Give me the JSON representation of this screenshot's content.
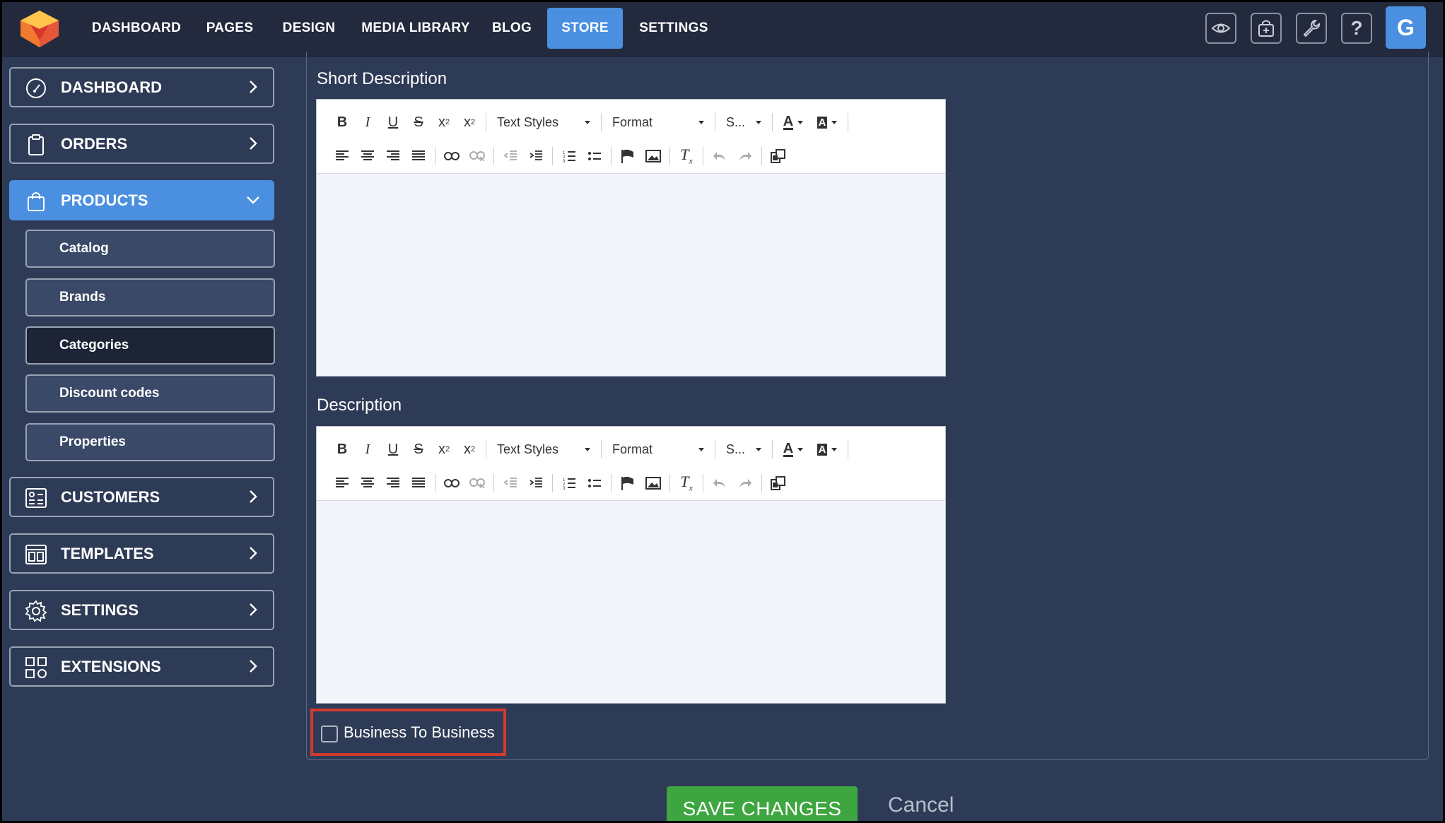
{
  "nav": {
    "items": [
      {
        "label": "DASHBOARD"
      },
      {
        "label": "PAGES"
      },
      {
        "label": "DESIGN"
      },
      {
        "label": "MEDIA LIBRARY"
      },
      {
        "label": "BLOG"
      },
      {
        "label": "STORE"
      },
      {
        "label": "SETTINGS"
      }
    ],
    "active": "STORE",
    "avatar_letter": "G"
  },
  "sidebar": {
    "items": [
      {
        "label": "DASHBOARD"
      },
      {
        "label": "ORDERS"
      },
      {
        "label": "PRODUCTS"
      },
      {
        "label": "CUSTOMERS"
      },
      {
        "label": "TEMPLATES"
      },
      {
        "label": "SETTINGS"
      },
      {
        "label": "EXTENSIONS"
      }
    ],
    "sub_items": [
      {
        "label": "Catalog"
      },
      {
        "label": "Brands"
      },
      {
        "label": "Categories"
      },
      {
        "label": "Discount codes"
      },
      {
        "label": "Properties"
      }
    ]
  },
  "form": {
    "short_description_label": "Short Description",
    "description_label": "Description",
    "toolbar": {
      "text_styles": "Text Styles",
      "format": "Format",
      "size": "S..."
    },
    "b2b_label": "Business To Business",
    "b2b_checked": false,
    "save_label": "SAVE CHANGES",
    "cancel_label": "Cancel"
  },
  "colors": {
    "accent": "#4a8fe0",
    "save": "#3ea640",
    "highlight": "#d23a2d",
    "background": "#2e3b56"
  }
}
